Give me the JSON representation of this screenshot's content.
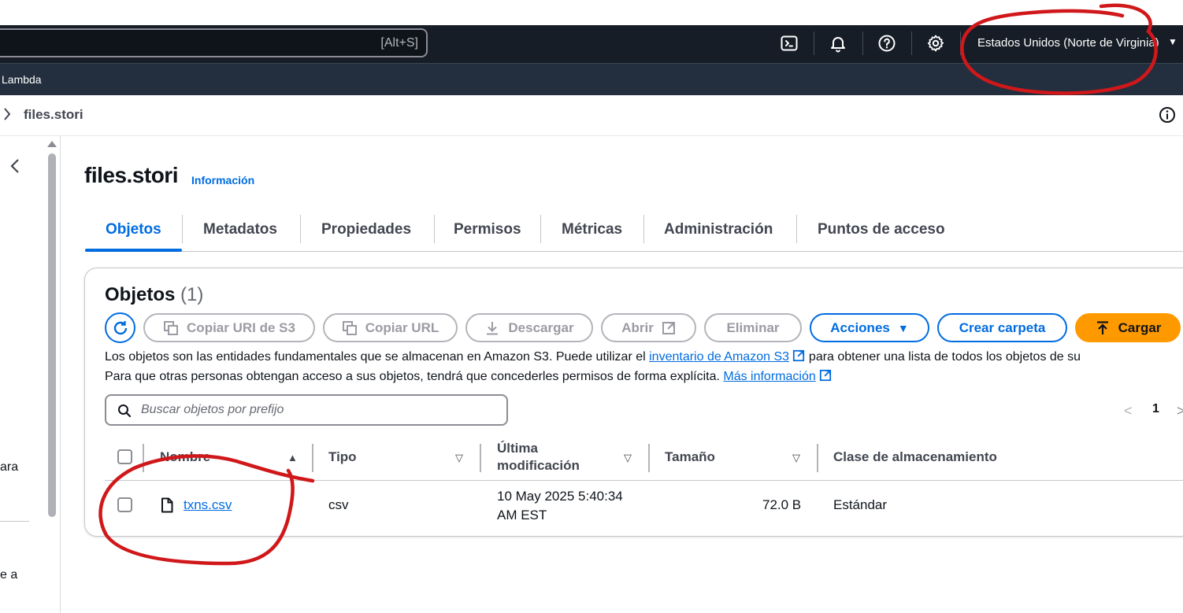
{
  "header": {
    "search_shortcut": "[Alt+S]",
    "region": "Estados Unidos (Norte de Virginia)",
    "icons": [
      "cloudshell-icon",
      "bell-icon",
      "help-icon",
      "settings-icon"
    ]
  },
  "services_bar": {
    "lambda_label": "Lambda"
  },
  "breadcrumb": {
    "current": "files.stori"
  },
  "left_panel": {
    "fragment_1": "ara",
    "fragment_2": "e a"
  },
  "page": {
    "title": "files.stori",
    "info_link": "Información"
  },
  "tabs": [
    {
      "label": "Objetos",
      "active": true
    },
    {
      "label": "Metadatos",
      "active": false
    },
    {
      "label": "Propiedades",
      "active": false
    },
    {
      "label": "Permisos",
      "active": false
    },
    {
      "label": "Métricas",
      "active": false
    },
    {
      "label": "Administración",
      "active": false
    },
    {
      "label": "Puntos de acceso",
      "active": false
    }
  ],
  "objects": {
    "title": "Objetos",
    "count": "(1)",
    "buttons": {
      "copy_uri": "Copiar URI de S3",
      "copy_url": "Copiar URL",
      "download": "Descargar",
      "open": "Abrir",
      "delete": "Eliminar",
      "actions": "Acciones",
      "create_folder": "Crear carpeta",
      "upload": "Cargar"
    },
    "description": {
      "line1_prefix": "Los objetos son las entidades fundamentales que se almacenan en Amazon S3. Puede utilizar el ",
      "line1_link": "inventario de Amazon S3",
      "line1_suffix": " para obtener una lista de todos los objetos de su",
      "line2_prefix": "Para que otras personas obtengan acceso a sus objetos, tendrá que concederles permisos de forma explícita. ",
      "line2_link": "Más información"
    },
    "search_placeholder": "Buscar objetos por prefijo",
    "pagination": {
      "current_page": "1"
    },
    "columns": {
      "name": "Nombre",
      "type": "Tipo",
      "modified_line1": "Última",
      "modified_line2": "modificación",
      "size": "Tamaño",
      "storage_class": "Clase de almacenamiento"
    },
    "rows": [
      {
        "name": "txns.csv",
        "type": "csv",
        "modified_line1": "10 May 2025 5:40:34",
        "modified_line2": "AM EST",
        "size": "72.0 B",
        "storage_class": "Estándar"
      }
    ]
  },
  "colors": {
    "header_bg": "#161d26",
    "services_bg": "#232f3e",
    "link_blue": "#006ce0",
    "primary_orange": "#ff9900",
    "annotation_red": "#d0181a"
  }
}
